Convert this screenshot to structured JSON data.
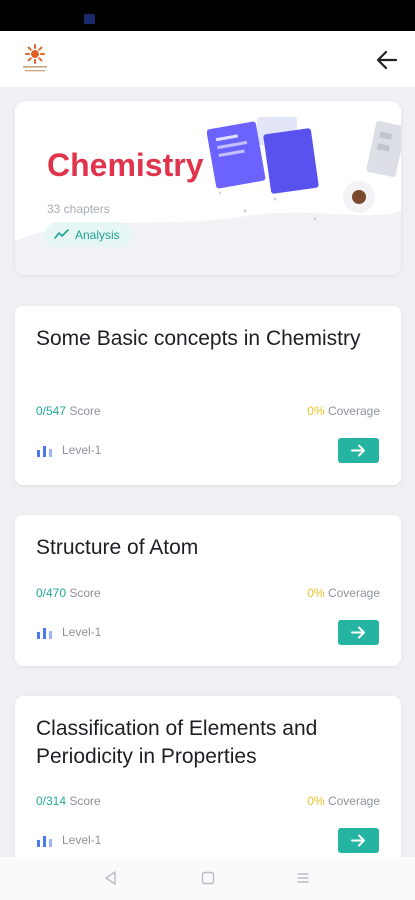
{
  "subject": {
    "title": "Chemistry",
    "chapters_label": "33 chapters",
    "analysis_label": "Analysis"
  },
  "chapters": [
    {
      "title": "Some Basic concepts in Chemistry",
      "score_value": "0/547",
      "score_label": "Score",
      "coverage_value": "0%",
      "coverage_label": "Coverage",
      "level": "Level-1"
    },
    {
      "title": "Structure of Atom",
      "score_value": "0/470",
      "score_label": "Score",
      "coverage_value": "0%",
      "coverage_label": "Coverage",
      "level": "Level-1"
    },
    {
      "title": "Classification of Elements and Periodicity in Properties",
      "score_value": "0/314",
      "score_label": "Score",
      "coverage_value": "0%",
      "coverage_label": "Coverage",
      "level": "Level-1"
    }
  ],
  "icons": {
    "logo": "app-logo-icon",
    "back": "back-arrow-icon",
    "analysis": "trend-line-icon",
    "level": "bar-chart-icon",
    "go": "arrow-right-icon",
    "nav_back": "nav-back-triangle-icon",
    "nav_home": "nav-home-square-icon",
    "nav_menu": "nav-menu-lines-icon"
  },
  "colors": {
    "subject_title": "#e0344c",
    "accent_teal": "#25b4a2",
    "coverage_yellow": "#e8c428",
    "background": "#eef0f4"
  }
}
